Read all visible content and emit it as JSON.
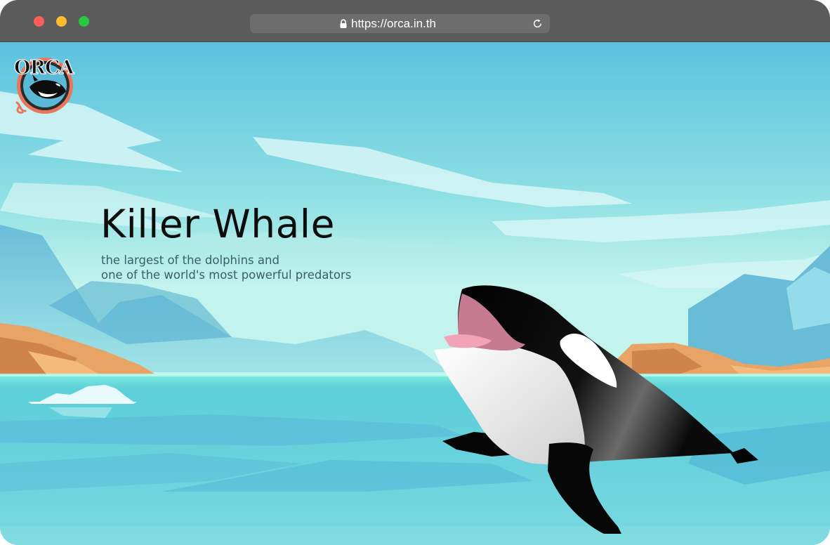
{
  "browser": {
    "url": "https://orca.in.th",
    "icons": [
      "lock-icon",
      "reload-icon"
    ],
    "traffic_lights": [
      "#ff5f57",
      "#febc2e",
      "#28c840"
    ]
  },
  "logo": {
    "text": "ORCA"
  },
  "hero": {
    "title": "Killer Whale",
    "subtitle_line1": "the largest of the dolphins and",
    "subtitle_line2": "one of the world's most powerful predators"
  },
  "colors": {
    "sky_top": "#5cc2df",
    "sky_horizon": "#c2f3ec",
    "sea": "#66cedc",
    "cliff": "#e7a465",
    "logo_ring": "#e7765a"
  }
}
